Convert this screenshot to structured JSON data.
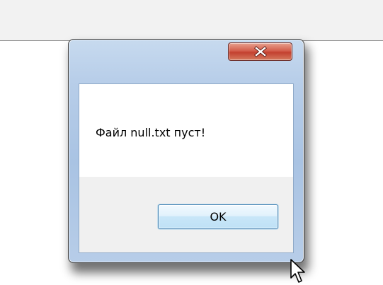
{
  "dialog": {
    "message": "Файл null.txt пуст!",
    "ok_label": "OK",
    "close_glyph": "close-icon"
  },
  "cursor": {
    "icon": "arrow-cursor-icon"
  },
  "colors": {
    "frame": "#b7cde8",
    "close_button": "#c94a3a",
    "ok_border": "#3c7fb1",
    "button_area": "#f0f0f0"
  }
}
